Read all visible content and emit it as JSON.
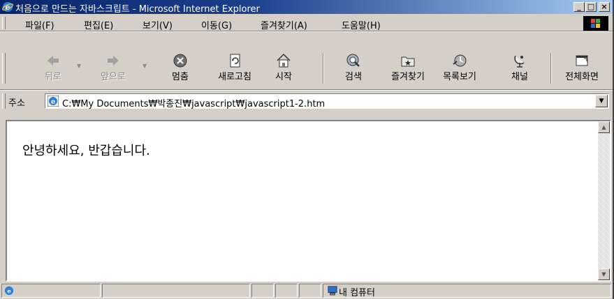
{
  "window": {
    "title": "처음으로 만드는 자바스크립트 - Microsoft Internet Explorer",
    "minimize": "_",
    "maximize": "□",
    "close": "×"
  },
  "menu": {
    "items": [
      {
        "label": "파일(F)"
      },
      {
        "label": "편집(E)"
      },
      {
        "label": "보기(V)"
      },
      {
        "label": "이동(G)"
      },
      {
        "label": "즐겨찾기(A)"
      },
      {
        "label": "도움말(H)"
      }
    ]
  },
  "toolbar": {
    "buttons": [
      {
        "label": "뒤로",
        "icon": "back-arrow-icon",
        "enabled": false
      },
      {
        "label": "앞으로",
        "icon": "forward-arrow-icon",
        "enabled": false
      },
      {
        "label": "멈춤",
        "icon": "stop-icon",
        "enabled": true
      },
      {
        "label": "새로고침",
        "icon": "refresh-icon",
        "enabled": true
      },
      {
        "label": "시작",
        "icon": "home-icon",
        "enabled": true
      },
      {
        "label": "검색",
        "icon": "search-icon",
        "enabled": true
      },
      {
        "label": "즐겨찾기",
        "icon": "favorites-icon",
        "enabled": true
      },
      {
        "label": "목록보기",
        "icon": "history-icon",
        "enabled": true
      },
      {
        "label": "채널",
        "icon": "channels-icon",
        "enabled": true
      },
      {
        "label": "전체화면",
        "icon": "fullscreen-icon",
        "enabled": true
      }
    ]
  },
  "address": {
    "label": "주소",
    "value": "C:₩My Documents₩박종진₩javascript₩javascript1-2.htm"
  },
  "page": {
    "text": "안녕하세요, 반갑습니다."
  },
  "status": {
    "zone": "내 컴퓨터"
  },
  "colors": {
    "titlebar_start": "#0a246a",
    "titlebar_end": "#a6caf0",
    "chrome": "#d4d0c8"
  }
}
